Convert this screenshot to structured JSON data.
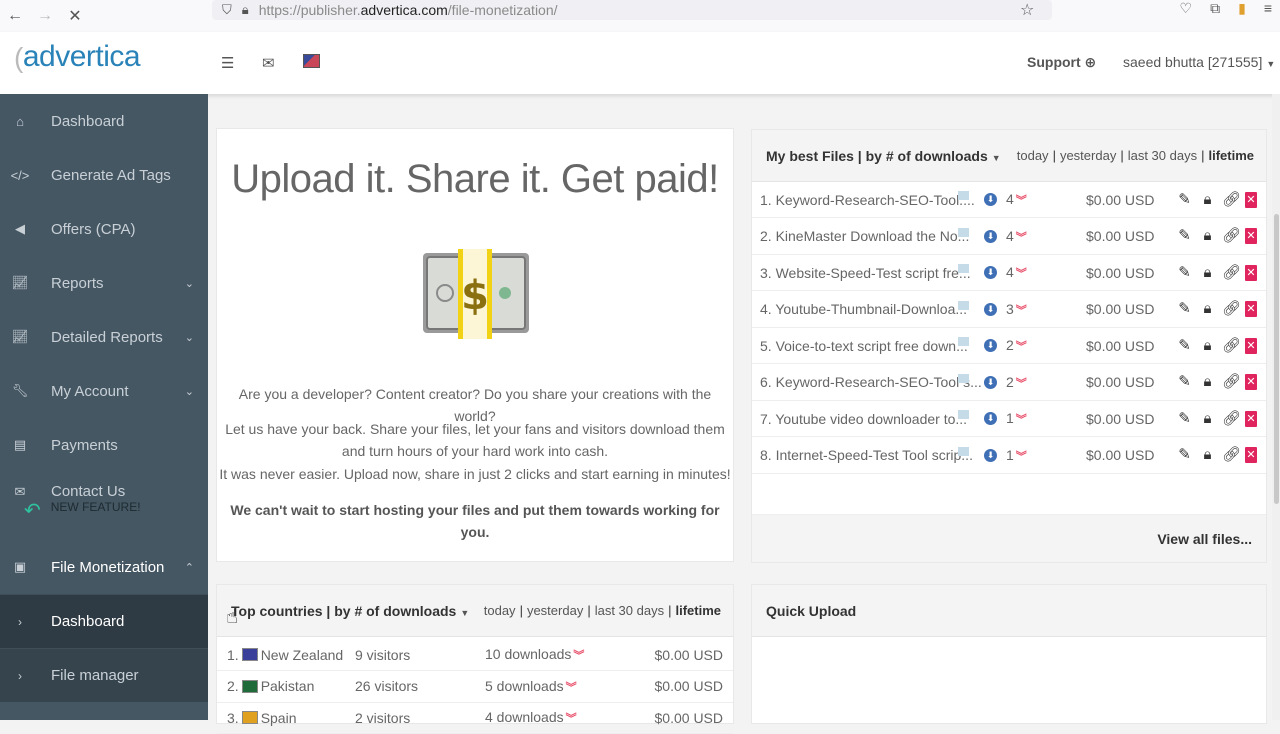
{
  "browser": {
    "url_prefix": "https://publisher.",
    "url_domain": "advertica.com",
    "url_path": "/file-monetization/"
  },
  "header": {
    "logo": "advertica",
    "support_label": "Support",
    "user_label": "saeed bhutta [271555]"
  },
  "sidebar": {
    "items": [
      {
        "label": "Dashboard",
        "icon": "home-icon"
      },
      {
        "label": "Generate Ad Tags",
        "icon": "code-icon"
      },
      {
        "label": "Offers (CPA)",
        "icon": "megaphone-icon"
      },
      {
        "label": "Reports",
        "icon": "chart-icon"
      },
      {
        "label": "Detailed Reports",
        "icon": "chart-icon"
      },
      {
        "label": "My Account",
        "icon": "wrench-icon"
      },
      {
        "label": "Payments",
        "icon": "card-icon"
      },
      {
        "label": "Contact Us",
        "icon": "envelope-icon"
      }
    ],
    "new_feature": "NEW FEATURE!",
    "file_monetization": "File Monetization",
    "sub_items": [
      {
        "label": "Dashboard"
      },
      {
        "label": "File manager"
      }
    ]
  },
  "hero": {
    "title": "Upload it. Share it. Get paid!",
    "line1": "Are you a developer? Content creator? Do you share your creations with the world?",
    "line2": "Let us have your back. Share your files, let your fans and visitors download them and turn hours of your hard work into cash.",
    "line3": "It was never easier. Upload now, share in just 2 clicks and start earning in minutes!",
    "bold_line": "We can't wait to start hosting your files and put them towards working for you."
  },
  "periods": {
    "today": "today",
    "yesterday": "yesterday",
    "last30": "last 30 days",
    "lifetime": "lifetime",
    "sep": "|"
  },
  "best_files": {
    "title": "My best Files | by # of downloads",
    "view_all": "View all files...",
    "rows": [
      {
        "name": "1. Keyword-Research-SEO-Tool....",
        "downloads": "4",
        "earnings": "$0.00 USD"
      },
      {
        "name": "2. KineMaster Download the No...",
        "downloads": "4",
        "earnings": "$0.00 USD"
      },
      {
        "name": "3. Website-Speed-Test script fre...",
        "downloads": "4",
        "earnings": "$0.00 USD"
      },
      {
        "name": "4. Youtube-Thumbnail-Downloa...",
        "downloads": "3",
        "earnings": "$0.00 USD"
      },
      {
        "name": "5. Voice-to-text script free down...",
        "downloads": "2",
        "earnings": "$0.00 USD"
      },
      {
        "name": "6. Keyword-Research-SEO-Tool s...",
        "downloads": "2",
        "earnings": "$0.00 USD"
      },
      {
        "name": "7. Youtube video downloader to...",
        "downloads": "1",
        "earnings": "$0.00 USD"
      },
      {
        "name": "8. Internet-Speed-Test Tool scrip...",
        "downloads": "1",
        "earnings": "$0.00 USD"
      }
    ]
  },
  "top_countries": {
    "title": "Top countries | by # of downloads",
    "rows": [
      {
        "rank": "1.",
        "country": "New Zealand",
        "visitors": "9 visitors",
        "downloads": "10 downloads",
        "earnings": "$0.00 USD",
        "flag_color": "#3a3f9a"
      },
      {
        "rank": "2.",
        "country": "Pakistan",
        "visitors": "26 visitors",
        "downloads": "5 downloads",
        "earnings": "$0.00 USD",
        "flag_color": "#1f6b3a"
      },
      {
        "rank": "3.",
        "country": "Spain",
        "visitors": "2 visitors",
        "downloads": "4 downloads",
        "earnings": "$0.00 USD",
        "flag_color": "#e0a020"
      }
    ]
  },
  "quick_upload": {
    "title": "Quick Upload"
  },
  "colors": {
    "sidebar_bg": "#465764",
    "brand": "#2a83b8",
    "delete": "#e0245e",
    "chevron_red": "#e84f6a"
  }
}
